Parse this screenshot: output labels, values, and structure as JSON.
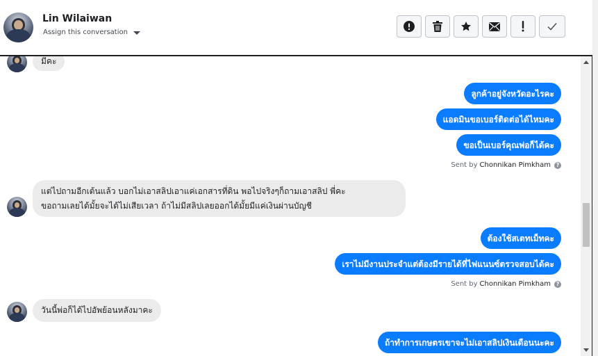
{
  "header": {
    "contact_name": "Lin Wilaiwan",
    "assign_label": "Assign this conversation",
    "actions": [
      {
        "name": "spam-button",
        "icon": "alert-circle-icon"
      },
      {
        "name": "delete-button",
        "icon": "trash-icon"
      },
      {
        "name": "star-button",
        "icon": "star-icon"
      },
      {
        "name": "mark-unread-button",
        "icon": "envelope-icon"
      },
      {
        "name": "flag-button",
        "icon": "exclamation-icon"
      },
      {
        "name": "mark-done-button",
        "icon": "checkmark-icon"
      }
    ]
  },
  "messages": {
    "m1": "มีคะ",
    "m2": "ลูกค้าอยู่จังหวัดอะไรคะ",
    "m3": "แอดมินขอเบอร์ติดต่อได้ไหมคะ",
    "m4": "ขอเป็นเบอร์คุณพ่อก็ได้คะ",
    "m5_line1": "แต่ไปถามอีกเต้นแล้ว บอกไม่เอาสลิปเอาแค่เอกสารที่ดิน พอไปจริงๆก็ถามเอาสลิป พี่คะ",
    "m5_line2": "ขอถามเลยได้มั้ยจะได้ไม่เสียเวลา ถ้าไม่มีสลิปเลยออกได้มั้ยมีแค่เงินผ่านบัญชี",
    "m6": "ต้องใช้สเตทเม็ทคะ",
    "m7": "เราไม่มีงานประจำแต่ต้องมีรายได้ที่ไฟแนนซ์ตรวจสอบได้คะ",
    "m8": "วันนี้พ่อก็ได้ไปอัพย้อนหลังมาคะ",
    "m9": "ถ้าทำการเกษตรเขาจะไม่เอาสลิปเงินเดือนนะคะ"
  },
  "sent_by": {
    "prefix": "Sent by",
    "agent": "Chonnikan Pimkham"
  },
  "colors": {
    "outgoing_bubble": "#0a7cff",
    "incoming_bubble": "#ebebeb"
  }
}
